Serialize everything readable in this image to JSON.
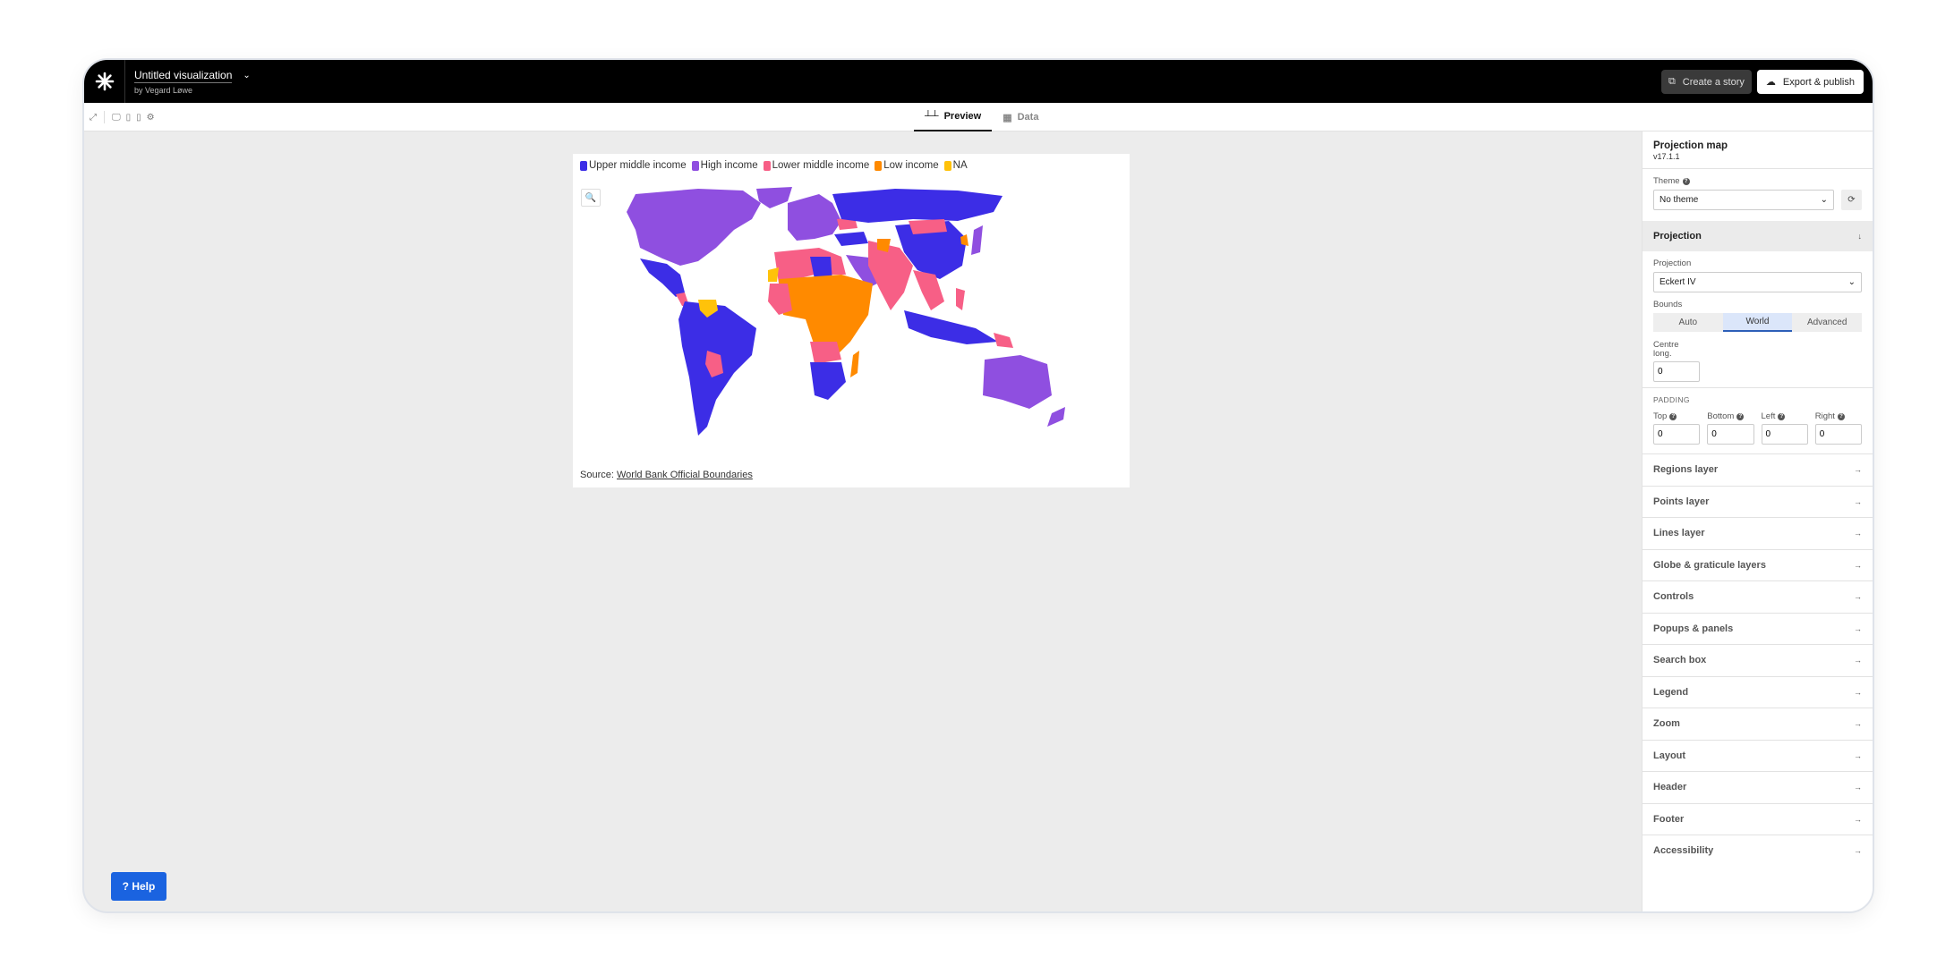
{
  "app": {
    "title": "Untitled visualization",
    "author": "by Vegard Løwe",
    "create_story_label": "Create a story",
    "export_label": "Export & publish"
  },
  "tabs": [
    {
      "label": "Preview",
      "active": true
    },
    {
      "label": "Data",
      "active": false
    }
  ],
  "toolbar": {
    "icons": [
      "expand-icon",
      "desktop-icon",
      "tablet-icon",
      "mobile-icon",
      "settings-icon"
    ]
  },
  "visualization": {
    "legend": [
      {
        "label": "Upper middle income",
        "color": "#3c2de6"
      },
      {
        "label": "High income",
        "color": "#8f4fe0"
      },
      {
        "label": "Lower middle income",
        "color": "#f75f86"
      },
      {
        "label": "Low income",
        "color": "#ff8a00"
      },
      {
        "label": "NA",
        "color": "#ffc20a"
      }
    ],
    "source_prefix": "Source:",
    "source_link": "World Bank Official Boundaries",
    "search_icon": "search-icon"
  },
  "help_label": "? Help",
  "panel": {
    "name": "Projection map",
    "version": "v17.1.1",
    "theme_label": "Theme",
    "theme_value": "No theme",
    "projection_section": "Projection",
    "projection_label": "Projection",
    "projection_value": "Eckert IV",
    "bounds_label": "Bounds",
    "bounds_options": [
      "Auto",
      "World",
      "Advanced"
    ],
    "bounds_selected": "World",
    "centre_label": "Centre long.",
    "centre_value": "0",
    "padding_title": "PADDING",
    "padding": [
      {
        "label": "Top",
        "value": "0"
      },
      {
        "label": "Bottom",
        "value": "0"
      },
      {
        "label": "Left",
        "value": "0"
      },
      {
        "label": "Right",
        "value": "0"
      }
    ],
    "sections": [
      "Regions layer",
      "Points layer",
      "Lines layer",
      "Globe & graticule layers",
      "Controls",
      "Popups & panels",
      "Search box",
      "Legend",
      "Zoom",
      "Layout",
      "Header",
      "Footer",
      "Accessibility"
    ]
  }
}
